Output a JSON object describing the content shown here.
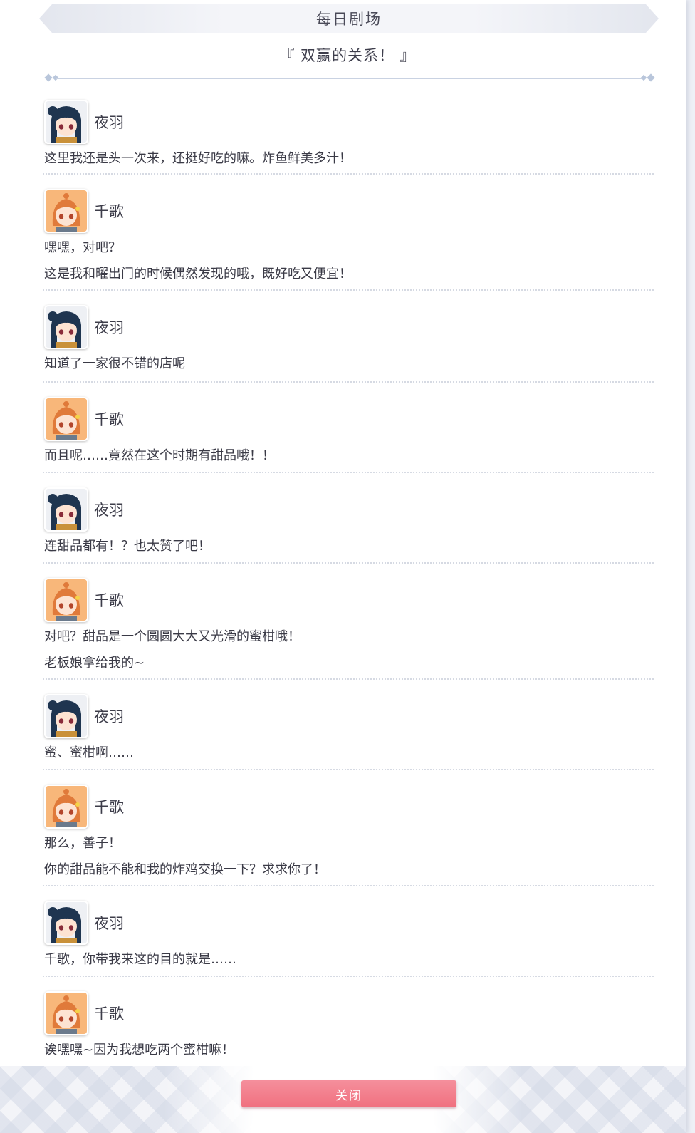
{
  "header": {
    "title": "每日剧场"
  },
  "story": {
    "title": "『 双赢的关系！ 』"
  },
  "avatars": {
    "yoshiko": {
      "icon": "yoshiko-avatar-icon",
      "hair": "#1f3550",
      "bg": "#eef0f4"
    },
    "chika": {
      "icon": "chika-avatar-icon",
      "hair": "#e07a3a",
      "bg": "#f8b77a"
    }
  },
  "dialogue": [
    {
      "speaker": "夜羽",
      "avatar": "yoshiko",
      "lines": [
        "这里我还是头一次来，还挺好吃的嘛。炸鱼鲜美多汁！"
      ]
    },
    {
      "speaker": "千歌",
      "avatar": "chika",
      "lines": [
        "嘿嘿，对吧？",
        "这是我和曜出门的时候偶然发现的哦，既好吃又便宜！"
      ]
    },
    {
      "speaker": "夜羽",
      "avatar": "yoshiko",
      "lines": [
        "知道了一家很不错的店呢"
      ]
    },
    {
      "speaker": "千歌",
      "avatar": "chika",
      "lines": [
        "而且呢……竟然在这个时期有甜品哦！！"
      ]
    },
    {
      "speaker": "夜羽",
      "avatar": "yoshiko",
      "lines": [
        "连甜品都有！？也太赞了吧！"
      ]
    },
    {
      "speaker": "千歌",
      "avatar": "chika",
      "lines": [
        "对吧？甜品是一个圆圆大大又光滑的蜜柑哦！",
        "老板娘拿给我的~"
      ]
    },
    {
      "speaker": "夜羽",
      "avatar": "yoshiko",
      "lines": [
        "蜜、蜜柑啊……"
      ]
    },
    {
      "speaker": "千歌",
      "avatar": "chika",
      "lines": [
        "那么，善子！",
        "你的甜品能不能和我的炸鸡交换一下？求求你了！"
      ]
    },
    {
      "speaker": "夜羽",
      "avatar": "yoshiko",
      "lines": [
        "千歌，你带我来这的目的就是……"
      ]
    },
    {
      "speaker": "千歌",
      "avatar": "chika",
      "lines": [
        "诶嘿嘿~因为我想吃两个蜜柑嘛！"
      ]
    }
  ],
  "footer": {
    "close_label": "关闭"
  },
  "colors": {
    "accent": "#f07584",
    "divider": "#c9d2e2"
  }
}
